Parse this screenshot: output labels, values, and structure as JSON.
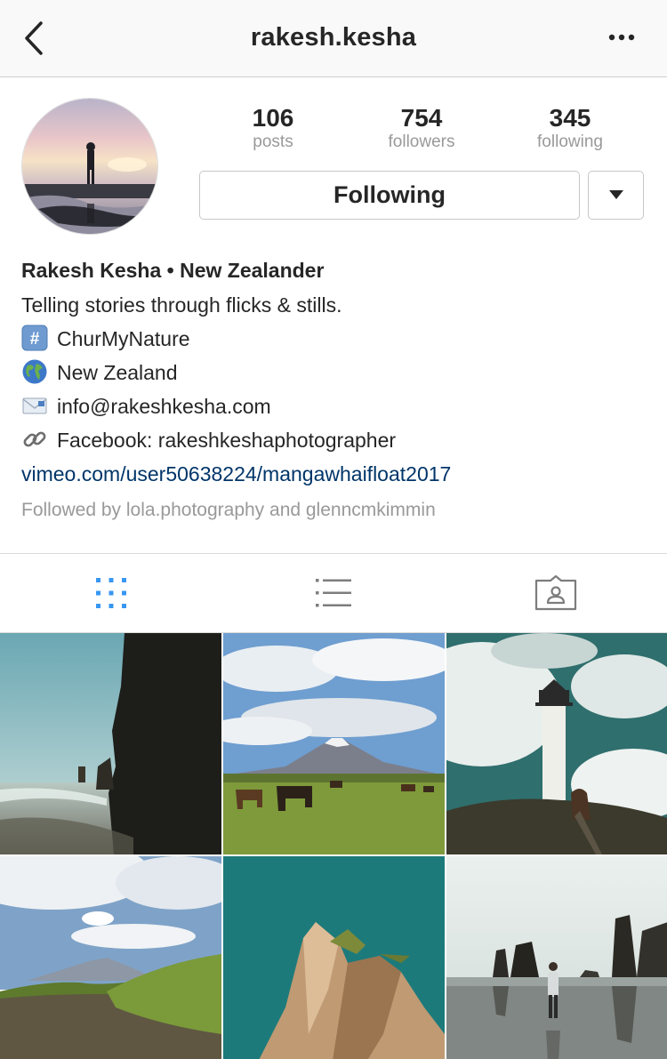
{
  "header": {
    "username": "rakesh.kesha",
    "back_icon": "chevron-left-icon",
    "more_icon": "more-dots-icon"
  },
  "stats": {
    "posts": {
      "value": "106",
      "label": "posts"
    },
    "followers": {
      "value": "754",
      "label": "followers"
    },
    "following": {
      "value": "345",
      "label": "following"
    }
  },
  "actions": {
    "following_label": "Following",
    "dropdown_icon": "caret-down-icon"
  },
  "bio": {
    "name": "Rakesh Kesha • New Zealander",
    "tagline": "Telling stories through flicks & stills.",
    "lines": [
      {
        "icon": "hashtag-icon",
        "text": "ChurMyNature"
      },
      {
        "icon": "globe-icon",
        "text": "New Zealand"
      },
      {
        "icon": "envelope-icon",
        "text": "info@rakeshkesha.com"
      },
      {
        "icon": "link-icon",
        "text": "Facebook: rakeshkeshaphotographer"
      }
    ],
    "link": "vimeo.com/user50638224/mangawhaifloat2017",
    "followed_by": "Followed by lola.photography and glenncmkimmin"
  },
  "tabs": [
    {
      "icon": "grid-icon",
      "active": true
    },
    {
      "icon": "list-icon",
      "active": false
    },
    {
      "icon": "tagged-icon",
      "active": false
    }
  ],
  "colors": {
    "accent": "#3897f0",
    "link": "#003569",
    "muted": "#999999",
    "text": "#262626"
  }
}
